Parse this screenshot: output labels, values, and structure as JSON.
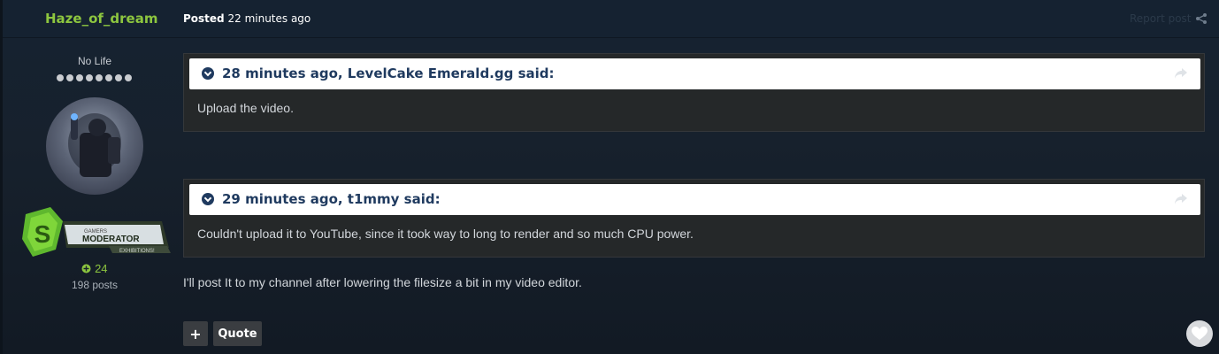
{
  "header": {
    "author_name": "Haze_of_dream",
    "posted_prefix": "Posted",
    "posted_time": "22 minutes ago",
    "report_label": "Report post"
  },
  "author": {
    "rank_title": "No Life",
    "rank_pips": 8,
    "badge": {
      "line1": "GAMERS",
      "line2": "MODERATOR",
      "line3": "EXHIBITIONS!"
    },
    "reputation": "24",
    "post_count": "198 posts"
  },
  "quotes": [
    {
      "cite": "28 minutes ago, LevelCake Emerald.gg said:",
      "body": "Upload the video."
    },
    {
      "cite": "29 minutes ago, t1mmy said:",
      "body": "Couldn't upload it to YouTube, since it took way to long to render and so much CPU power."
    }
  ],
  "post_text": "I'll post It to my channel after lowering the filesize a bit in my video editor.",
  "actions": {
    "plus_label": "+",
    "quote_label": "Quote"
  },
  "colors": {
    "author_green": "#8dc63f",
    "quote_cite_blue": "#1f3a5f",
    "background": "#17212d"
  },
  "icons": {
    "share": "share-icon",
    "quote_toggle": "chevron-down-icon",
    "quote_share": "reply-arrow-icon",
    "reputation": "plus-circle-icon",
    "like": "heart-icon"
  }
}
